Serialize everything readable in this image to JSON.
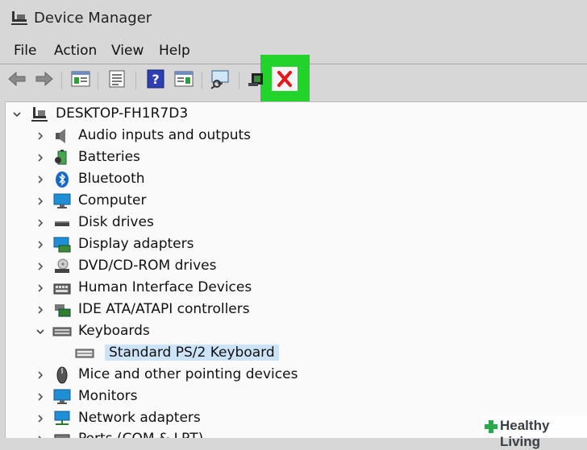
{
  "window": {
    "title": "Device Manager",
    "icon": "device-manager-icon"
  },
  "menu": [
    "File",
    "Action",
    "View",
    "Help"
  ],
  "toolbar": {
    "buttons": [
      "back-arrow-icon",
      "forward-arrow-icon",
      "properties-panel-icon",
      "tree-view-icon",
      "help-icon",
      "action-pane-icon",
      "scan-hardware-icon",
      "update-driver-icon",
      "uninstall-device-icon"
    ],
    "highlight_color": "#22d32b"
  },
  "tree": {
    "root": "DESKTOP-FH1R7D3",
    "categories": [
      {
        "label": "Audio inputs and outputs",
        "icon": "speaker-icon",
        "expanded": false
      },
      {
        "label": "Batteries",
        "icon": "battery-icon",
        "expanded": false
      },
      {
        "label": "Bluetooth",
        "icon": "bluetooth-icon",
        "expanded": false
      },
      {
        "label": "Computer",
        "icon": "computer-icon",
        "expanded": false
      },
      {
        "label": "Disk drives",
        "icon": "disk-drive-icon",
        "expanded": false
      },
      {
        "label": "Display adapters",
        "icon": "display-adapter-icon",
        "expanded": false
      },
      {
        "label": "DVD/CD-ROM drives",
        "icon": "dvd-drive-icon",
        "expanded": false
      },
      {
        "label": "Human Interface Devices",
        "icon": "hid-icon",
        "expanded": false
      },
      {
        "label": "IDE ATA/ATAPI controllers",
        "icon": "ide-controller-icon",
        "expanded": false
      },
      {
        "label": "Keyboards",
        "icon": "keyboard-icon",
        "expanded": true
      },
      {
        "label": "Standard PS/2 Keyboard",
        "icon": "keyboard-device-icon",
        "child": true,
        "selected": true
      },
      {
        "label": "Mice and other pointing devices",
        "icon": "mouse-icon",
        "expanded": false
      },
      {
        "label": "Monitors",
        "icon": "monitor-icon",
        "expanded": false
      },
      {
        "label": "Network adapters",
        "icon": "network-adapter-icon",
        "expanded": false
      },
      {
        "label": "Ports (COM & LPT)",
        "icon": "port-icon",
        "expanded": false
      }
    ]
  },
  "watermark": {
    "text": "Healthy Living"
  }
}
